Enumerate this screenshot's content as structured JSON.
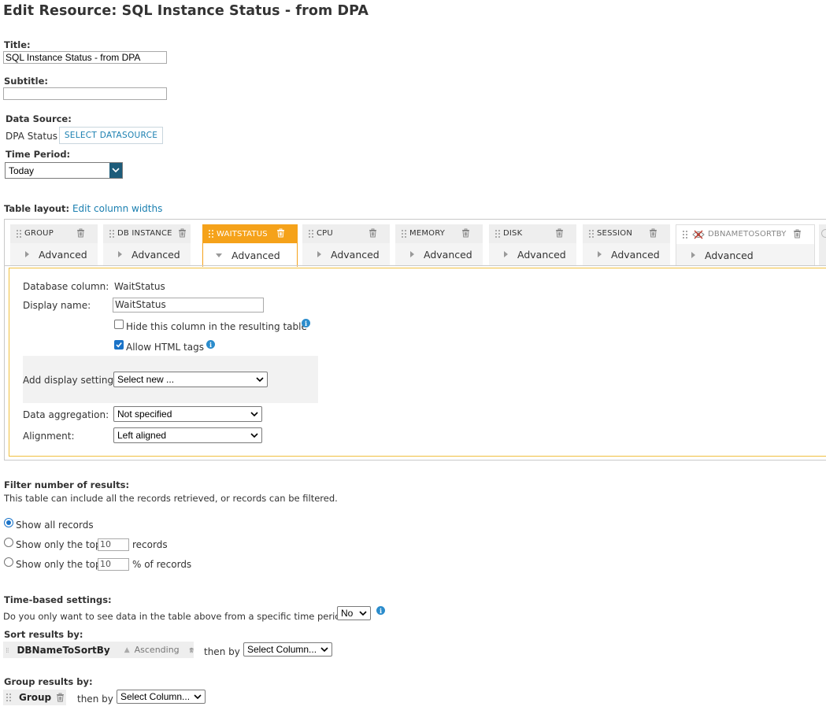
{
  "page_title": "Edit Resource: SQL Instance Status - from DPA",
  "title_field": {
    "label": "Title:",
    "value": "SQL Instance Status - from DPA"
  },
  "subtitle_field": {
    "label": "Subtitle:",
    "value": ""
  },
  "data_source": {
    "label": "Data Source:",
    "value": "DPA Status",
    "button": "SELECT DATASOURCE"
  },
  "time_period": {
    "label": "Time Period:",
    "value": "Today"
  },
  "table_layout": {
    "label": "Table layout:",
    "link": "Edit column widths"
  },
  "columns": [
    {
      "name": "GROUP",
      "advanced": "Advanced"
    },
    {
      "name": "DB INSTANCE",
      "advanced": "Advanced"
    },
    {
      "name": "WAITSTATUS",
      "advanced": "Advanced"
    },
    {
      "name": "CPU",
      "advanced": "Advanced"
    },
    {
      "name": "MEMORY",
      "advanced": "Advanced"
    },
    {
      "name": "DISK",
      "advanced": "Advanced"
    },
    {
      "name": "SESSION",
      "advanced": "Advanced"
    },
    {
      "name": "DBNAMETOSORTBY",
      "advanced": "Advanced"
    }
  ],
  "column_settings": {
    "db_column_label": "Database column:",
    "db_column_value": "WaitStatus",
    "display_name_label": "Display name:",
    "display_name_value": "WaitStatus",
    "hide_label": "Hide this column in the resulting table",
    "hide_checked": false,
    "html_label": "Allow HTML tags",
    "html_checked": true,
    "add_display_label": "Add display settings:",
    "add_display_value": "Select new ...",
    "aggregation_label": "Data aggregation:",
    "aggregation_value": "Not specified",
    "alignment_label": "Alignment:",
    "alignment_value": "Left aligned"
  },
  "filter": {
    "label": "Filter number of results:",
    "desc": "This table can include all the records retrieved, or records can be filtered.",
    "opt_all": "Show all records",
    "opt_top": "Show only the top",
    "top_value": "10",
    "top_suffix": "records",
    "opt_pct": "Show only the top",
    "pct_value": "10",
    "pct_suffix": "% of records",
    "selected": "all"
  },
  "time_based": {
    "label": "Time-based settings:",
    "question": "Do you only want to see data in the table above from a specific time period?",
    "value": "No"
  },
  "sort": {
    "label": "Sort results by:",
    "column": "DBNameToSortBy",
    "order": "Ascending",
    "then_by": "then by",
    "select": "Select Column..."
  },
  "group": {
    "label": "Group results by:",
    "column": "Group",
    "then_by": "then by",
    "select": "Select Column..."
  },
  "colors": {
    "accent": "#f5a21a",
    "link": "#1a7fb0",
    "info": "#2b8ccc"
  }
}
